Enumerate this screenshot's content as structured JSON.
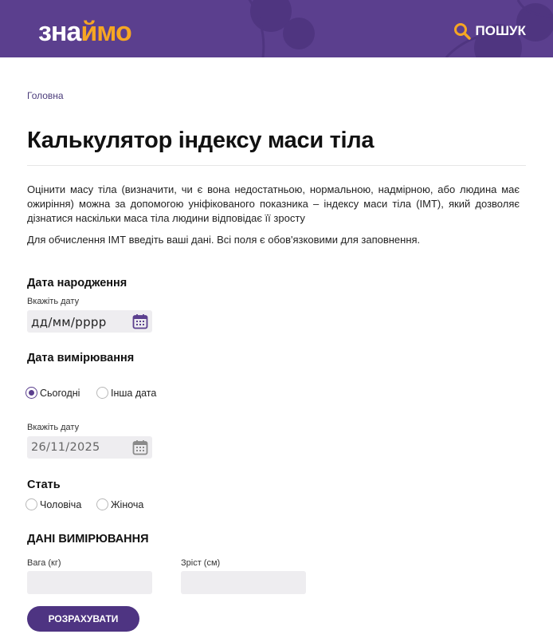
{
  "header": {
    "logo_white": "зна",
    "logo_yellow": "ймо",
    "search_label": "ПОШУК",
    "colors": {
      "background": "#5b3f8e",
      "accent": "#f6a623"
    }
  },
  "breadcrumb": {
    "home": "Головна"
  },
  "page": {
    "title": "Калькулятор індексу маси тіла",
    "intro": "Оцінити масу тіла (визначити, чи є вона недостатньою, нормальною, надмірною, або людина має ожиріння) можна за допомогою уніфікованого показника – індексу маси тіла (ІМТ), який дозволяє дізнатися наскільки маса тіла людини відповідає її зросту",
    "instructions": "Для обчислення ІМТ введіть ваші дані. Всі поля є обов'язковими для заповнення."
  },
  "birth_date": {
    "title": "Дата народження",
    "hint": "Вкажіть дату",
    "value": "дд/мм/рррр"
  },
  "measure_date": {
    "title": "Дата вимірювання",
    "options": [
      {
        "label": "Сьогодні",
        "checked": true
      },
      {
        "label": "Інша дата",
        "checked": false
      }
    ],
    "hint": "Вкажіть дату",
    "value": "26/11/2025"
  },
  "sex": {
    "title": "Стать",
    "options": [
      {
        "label": "Чоловіча",
        "checked": false
      },
      {
        "label": "Жіноча",
        "checked": false
      }
    ]
  },
  "measurements": {
    "title": "ДАНІ ВИМІРЮВАННЯ",
    "weight_label": "Вага (кг)",
    "weight_value": "",
    "height_label": "Зріст (см)",
    "height_value": ""
  },
  "submit_label": "РОЗРАХУВАТИ"
}
